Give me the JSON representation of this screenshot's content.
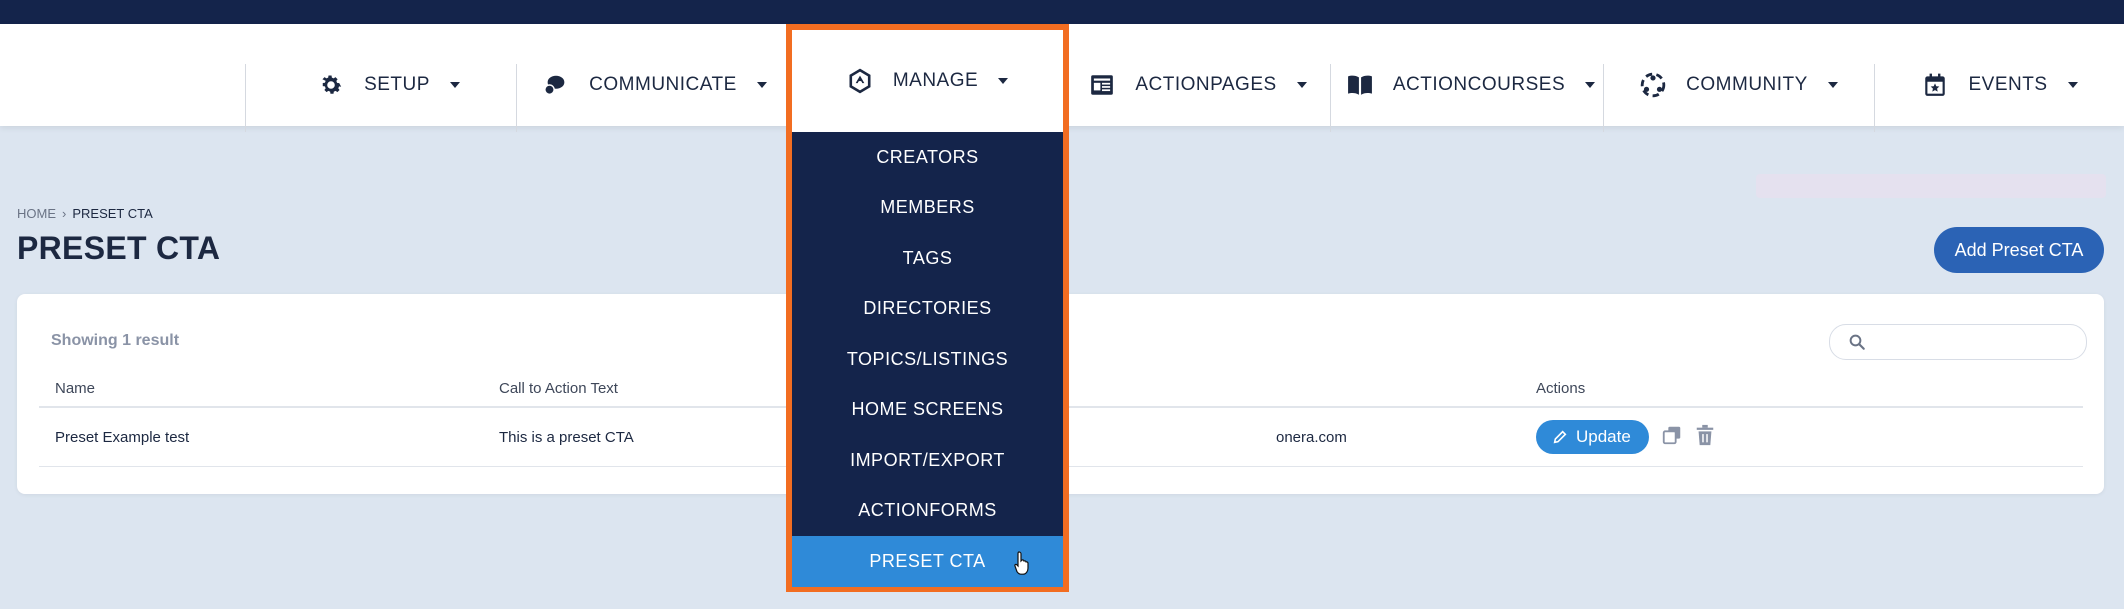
{
  "nav": {
    "items": [
      {
        "label": "SETUP",
        "icon": "gear-icon"
      },
      {
        "label": "COMMUNICATE",
        "icon": "chat-icon"
      },
      {
        "label": "MANAGE",
        "icon": "manage-icon"
      },
      {
        "label": "ACTIONPAGES",
        "icon": "page-icon"
      },
      {
        "label": "ACTIONCOURSES",
        "icon": "book-icon"
      },
      {
        "label": "COMMUNITY",
        "icon": "community-icon"
      },
      {
        "label": "EVENTS",
        "icon": "calendar-icon"
      }
    ]
  },
  "manage_menu": {
    "items": [
      "CREATORS",
      "MEMBERS",
      "TAGS",
      "DIRECTORIES",
      "TOPICS/LISTINGS",
      "HOME SCREENS",
      "IMPORT/EXPORT",
      "ACTIONFORMS",
      "PRESET CTA"
    ],
    "active": "PRESET CTA"
  },
  "breadcrumb": {
    "home": "HOME",
    "current": "PRESET CTA"
  },
  "page": {
    "title": "PRESET CTA",
    "add_button": "Add Preset CTA"
  },
  "table": {
    "showing": "Showing 1 result",
    "search_placeholder": "",
    "headers": [
      "Name",
      "Call to Action Text",
      "",
      "Actions"
    ],
    "rows": [
      {
        "name": "Preset Example test",
        "cta_text": "This is a preset CTA",
        "link": "onera.com",
        "update_label": "Update"
      }
    ]
  },
  "colors": {
    "navy": "#14244b",
    "accent_blue": "#2f8ad8",
    "highlight_orange": "#f26d21",
    "button_blue": "#2b63b5"
  }
}
